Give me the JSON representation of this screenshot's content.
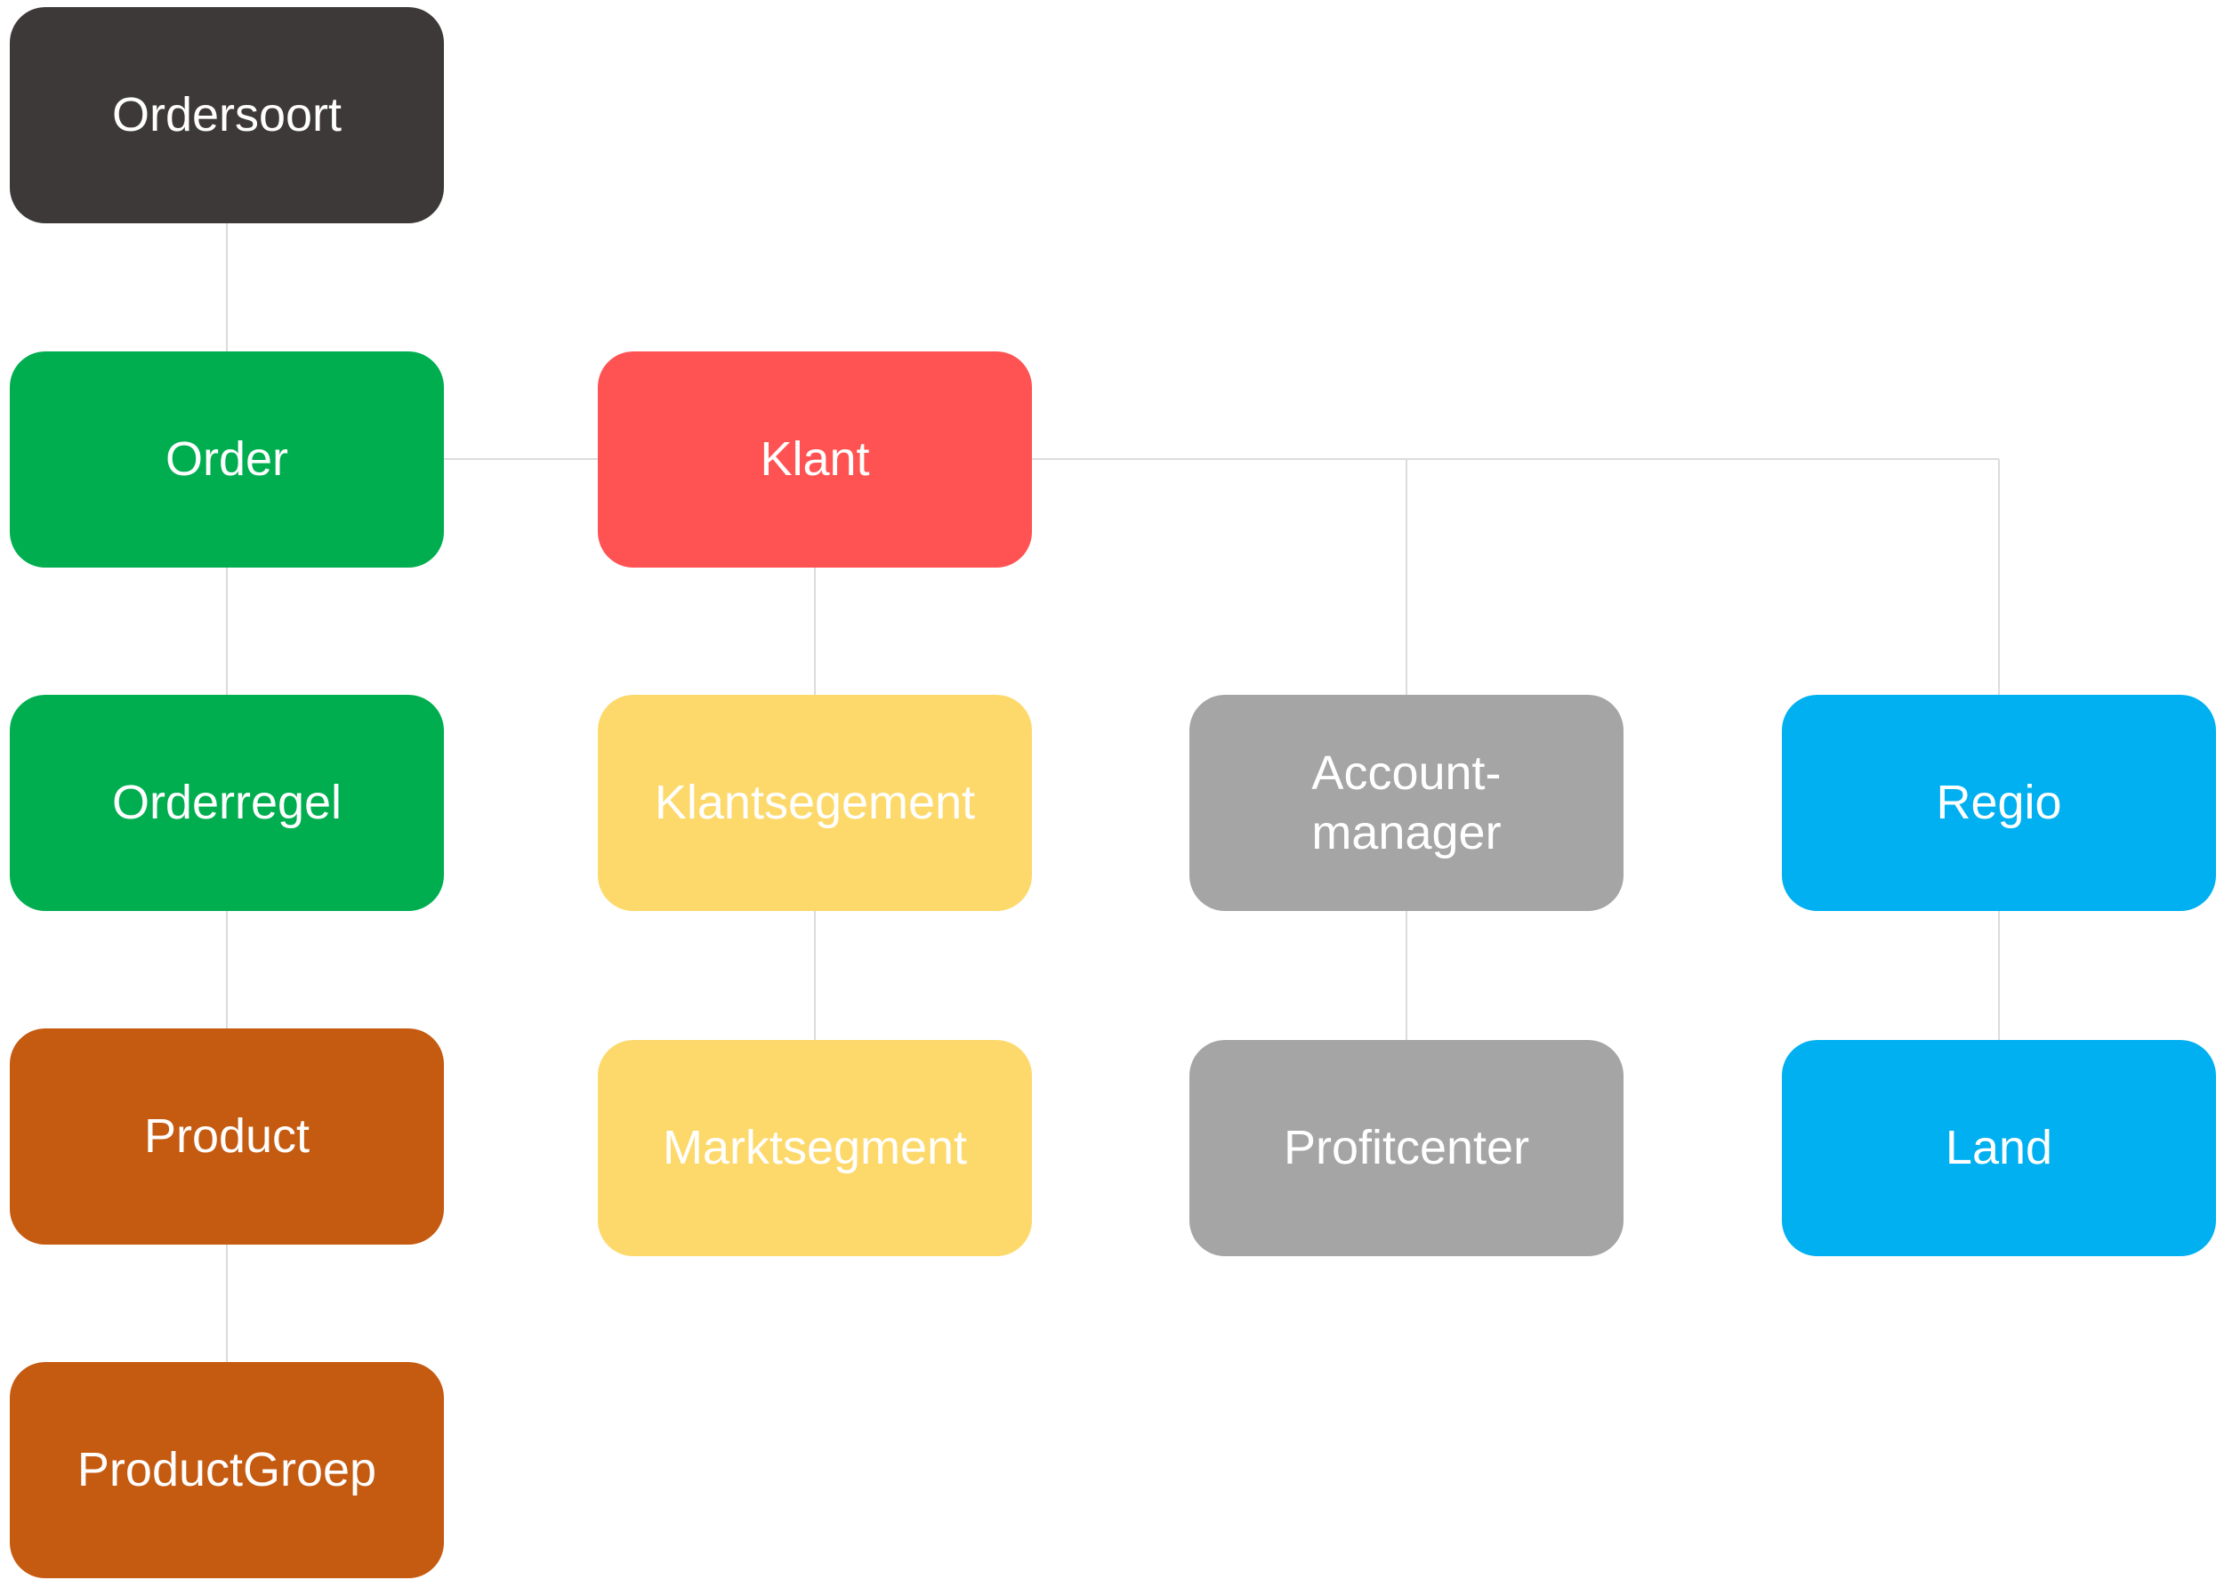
{
  "diagram": {
    "type": "hierarchy",
    "nodes": [
      {
        "id": "ordersoort",
        "label": "Ordersoort",
        "color": "#3d3938"
      },
      {
        "id": "order",
        "label": "Order",
        "color": "#00ae50"
      },
      {
        "id": "orderregel",
        "label": "Orderregel",
        "color": "#00ae50"
      },
      {
        "id": "product",
        "label": "Product",
        "color": "#c55a11"
      },
      {
        "id": "productgroep",
        "label": "ProductGroep",
        "color": "#c55a11"
      },
      {
        "id": "klant",
        "label": "Klant",
        "color": "#ff5353"
      },
      {
        "id": "klantsegement",
        "label": "Klantsegement",
        "color": "#fdd96b"
      },
      {
        "id": "marktsegment",
        "label": "Marktsegment",
        "color": "#fdd96b"
      },
      {
        "id": "accountmanager",
        "label_lines": [
          "Account-",
          "manager"
        ],
        "color": "#a5a5a5"
      },
      {
        "id": "profitcenter",
        "label": "Profitcenter",
        "color": "#a5a5a5"
      },
      {
        "id": "regio",
        "label": "Regio",
        "color": "#00b0f0"
      },
      {
        "id": "land",
        "label": "Land",
        "color": "#00b0f0"
      }
    ],
    "edges": [
      [
        "ordersoort",
        "order"
      ],
      [
        "order",
        "orderregel"
      ],
      [
        "orderregel",
        "product"
      ],
      [
        "product",
        "productgroep"
      ],
      [
        "order",
        "klant"
      ],
      [
        "klant",
        "klantsegement"
      ],
      [
        "klantsegement",
        "marktsegment"
      ],
      [
        "klant",
        "accountmanager"
      ],
      [
        "accountmanager",
        "profitcenter"
      ],
      [
        "klant",
        "regio"
      ],
      [
        "regio",
        "land"
      ]
    ],
    "connector_color": "#dcdcdc"
  }
}
